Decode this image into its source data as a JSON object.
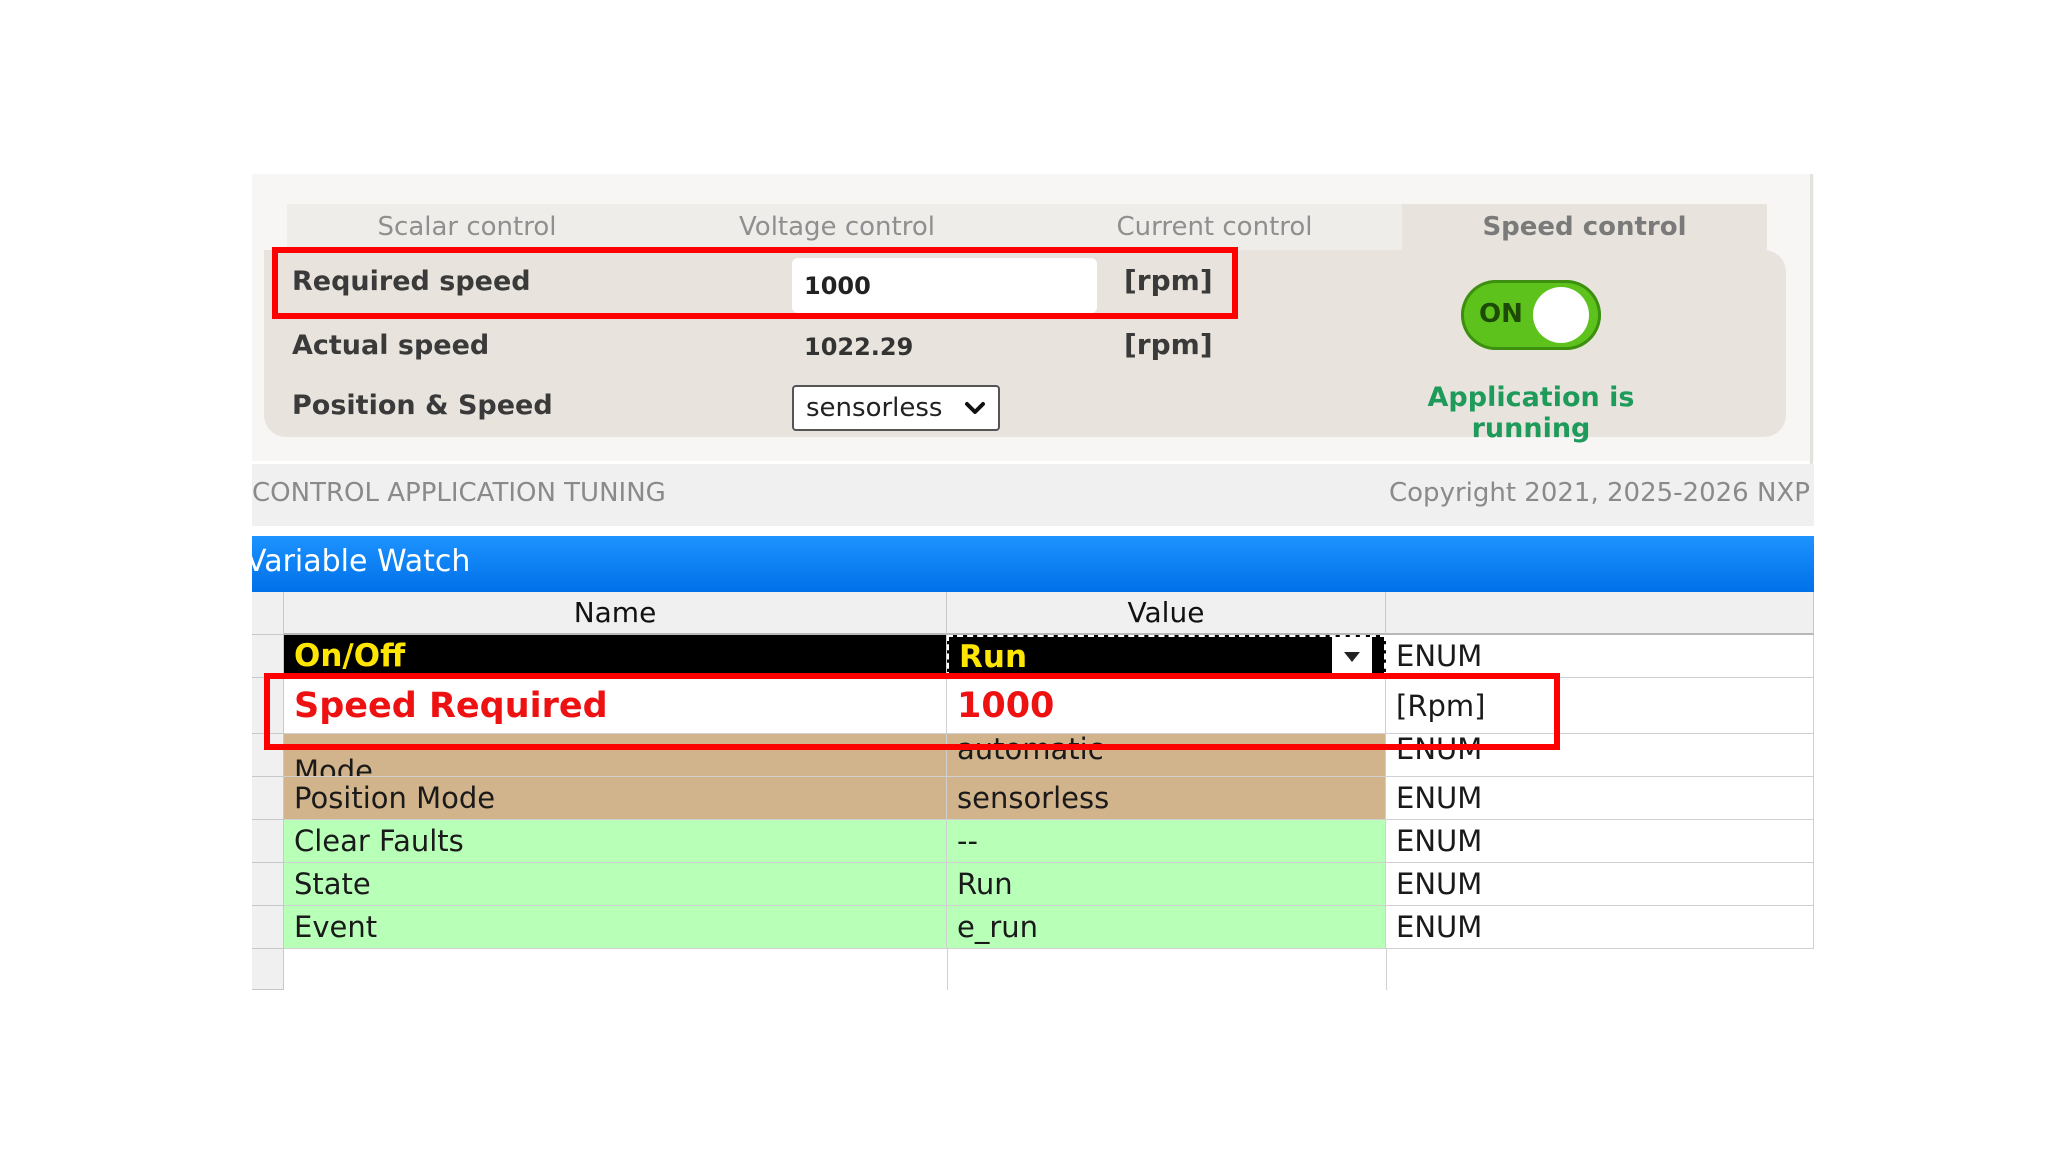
{
  "tabs": [
    "Scalar control",
    "Voltage control",
    "Current control",
    "Speed control"
  ],
  "active_tab": "Speed control",
  "speed_panel": {
    "required_speed_label": "Required speed",
    "required_speed_value": "1000",
    "required_unit": "[rpm]",
    "actual_speed_label": "Actual speed",
    "actual_speed_value": "1022.29",
    "actual_unit": "[rpm]",
    "position_label": "Position & Speed",
    "position_value": "sensorless",
    "toggle_label": "ON",
    "status_text": "Application is running"
  },
  "footer": {
    "left": "CONTROL APPLICATION TUNING",
    "right": "Copyright 2021, 2025-2026 NXP"
  },
  "variable_watch": {
    "title": "Variable Watch",
    "columns": [
      "Name",
      "Value",
      ""
    ],
    "rows": [
      {
        "name": "On/Off",
        "value": "Run",
        "unit": "ENUM"
      },
      {
        "name": "Speed Required",
        "value": "1000",
        "unit": "[Rpm]"
      },
      {
        "name": "Mode",
        "value": "automatic",
        "unit": "ENUM"
      },
      {
        "name": "Position Mode",
        "value": "sensorless",
        "unit": "ENUM"
      },
      {
        "name": "Clear Faults",
        "value": "--",
        "unit": "ENUM"
      },
      {
        "name": "State",
        "value": "Run",
        "unit": "ENUM"
      },
      {
        "name": "Event",
        "value": "e_run",
        "unit": "ENUM"
      }
    ]
  },
  "colors": {
    "accent_blue": "#0a84ff",
    "toggle_green": "#5ec21d",
    "status_green": "#1e9a5a",
    "highlight_red": "#ff0000",
    "row_tan": "#d2b48c",
    "row_green": "#b8ffb8"
  }
}
